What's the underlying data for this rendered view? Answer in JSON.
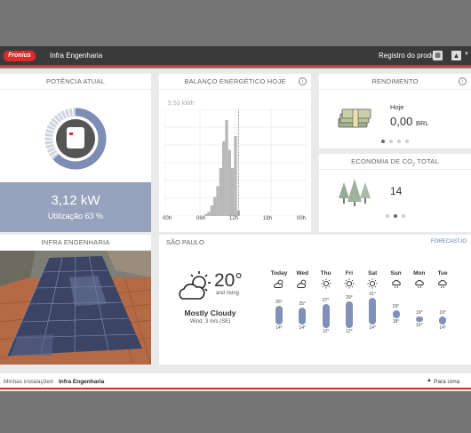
{
  "header": {
    "logo_text": "Fronius",
    "site_name": "Infra Engenharia",
    "product_register": "Registro do produto"
  },
  "potencia": {
    "title": "POTÊNCIA ATUAL",
    "value": "3,12 kW",
    "utilization": "Utilização 63 %",
    "utilization_fraction": 0.63
  },
  "balanco": {
    "title": "BALANÇO ENERGÉTICO HOJE",
    "info": "i",
    "unit_label": "5,53 kWh",
    "x_ticks": [
      "00h",
      "06h",
      "12h",
      "18h",
      "00h"
    ]
  },
  "chart_data": {
    "type": "area",
    "title": "BALANÇO ENERGÉTICO HOJE",
    "xlabel": "",
    "ylabel": "",
    "x": [
      6.5,
      7.0,
      7.5,
      8.0,
      8.5,
      9.0,
      9.5,
      10.0,
      10.5,
      11.0,
      11.5,
      12.0,
      12.5
    ],
    "values": [
      0.0,
      0.02,
      0.04,
      0.1,
      0.18,
      0.28,
      0.45,
      0.7,
      0.9,
      0.62,
      0.45,
      0.75,
      0.05
    ],
    "xlim": [
      0,
      24
    ],
    "ylim": [
      0,
      1
    ],
    "grid": true
  },
  "rendimento": {
    "title": "RENDIMENTO",
    "label": "Hoje",
    "value": "0,00",
    "unit": "BRL",
    "info": "i"
  },
  "economia": {
    "title_main": "ECONOMIA DE CO",
    "title_sub": "2",
    "title_end": " TOTAL",
    "value": "14"
  },
  "infra": {
    "title": "INFRA ENGENHARIA"
  },
  "weather": {
    "title": "SÃO PAULO",
    "link": "FORECAST.IO",
    "temp": "20°",
    "trend": "and rising",
    "condition": "Mostly Cloudy",
    "wind": "Wind: 3 m/s (SE)",
    "days": [
      {
        "name": "Today",
        "hi": "26°",
        "lo": "14°",
        "icon": "partly-cloudy-icon",
        "hi_v": 26,
        "lo_v": 14
      },
      {
        "name": "Wed",
        "hi": "25°",
        "lo": "14°",
        "icon": "partly-cloudy-icon",
        "hi_v": 25,
        "lo_v": 14
      },
      {
        "name": "Thu",
        "hi": "27°",
        "lo": "12°",
        "icon": "sun-icon",
        "hi_v": 27,
        "lo_v": 12
      },
      {
        "name": "Fri",
        "hi": "29°",
        "lo": "12°",
        "icon": "sun-icon",
        "hi_v": 29,
        "lo_v": 12
      },
      {
        "name": "Sat",
        "hi": "31°",
        "lo": "14°",
        "icon": "sun-icon",
        "hi_v": 31,
        "lo_v": 14
      },
      {
        "name": "Sun",
        "hi": "23°",
        "lo": "18°",
        "icon": "rain-icon",
        "hi_v": 23,
        "lo_v": 18
      },
      {
        "name": "Mon",
        "hi": "19°",
        "lo": "16°",
        "icon": "rain-icon",
        "hi_v": 19,
        "lo_v": 16
      },
      {
        "name": "Tue",
        "hi": "19°",
        "lo": "14°",
        "icon": "rain-icon",
        "hi_v": 19,
        "lo_v": 14
      }
    ]
  },
  "footer": {
    "crumb_root": "Minhas instalações",
    "separator": "›",
    "crumb_current": "Infra Engenharia",
    "to_top": "Para cima"
  },
  "colors": {
    "accent": "#e0292a",
    "header_bg": "#3a3a3a",
    "panel_blue": "#97a3bc",
    "bar_blue": "#8090b8"
  }
}
